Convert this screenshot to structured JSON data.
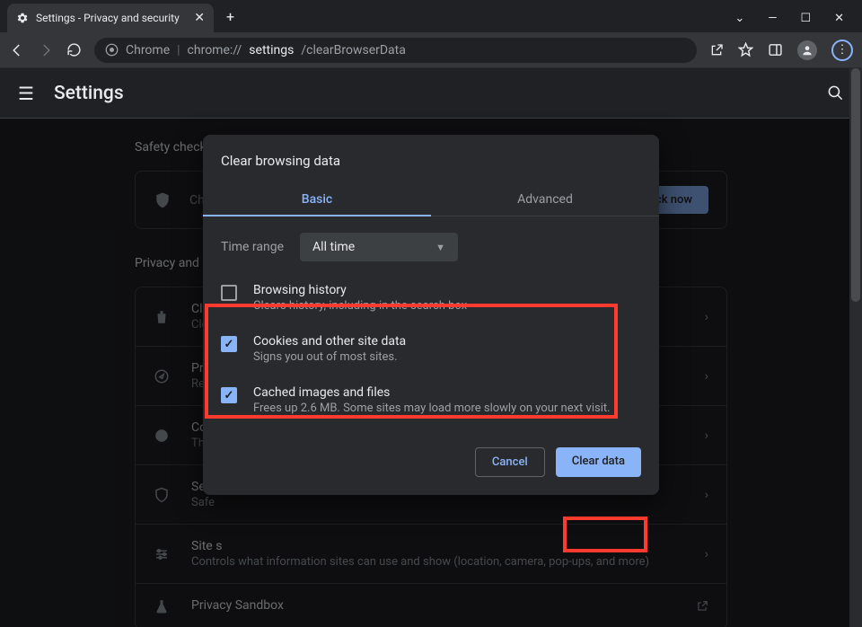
{
  "titlebar": {
    "tab_title": "Settings - Privacy and security"
  },
  "urlbar": {
    "scheme_label": "Chrome",
    "url_prefix": "chrome://",
    "url_bold": "settings",
    "url_suffix": "/clearBrowserData"
  },
  "settings_header": {
    "title": "Settings"
  },
  "sections": {
    "safety_label": "Safety check",
    "safety_row_text": "Chro",
    "safety_button": "eck now",
    "privacy_label": "Privacy and s",
    "rows": [
      {
        "title": "Clear",
        "sub": "Clear"
      },
      {
        "title": "Priva",
        "sub": "Revie"
      },
      {
        "title": "Cook",
        "sub": "Third"
      },
      {
        "title": "Secu",
        "sub": "Safe"
      },
      {
        "title": "Site s",
        "sub": "Controls what information sites can use and show (location, camera, pop-ups, and more)"
      },
      {
        "title": "Privacy Sandbox",
        "sub": ""
      }
    ]
  },
  "dialog": {
    "title": "Clear browsing data",
    "tab_basic": "Basic",
    "tab_advanced": "Advanced",
    "time_range_label": "Time range",
    "time_range_value": "All time",
    "options": [
      {
        "title": "Browsing history",
        "sub": "Clears history, including in the search box",
        "checked": false
      },
      {
        "title": "Cookies and other site data",
        "sub": "Signs you out of most sites.",
        "checked": true
      },
      {
        "title": "Cached images and files",
        "sub": "Frees up 2.6 MB. Some sites may load more slowly on your next visit.",
        "checked": true
      }
    ],
    "cancel": "Cancel",
    "confirm": "Clear data"
  }
}
